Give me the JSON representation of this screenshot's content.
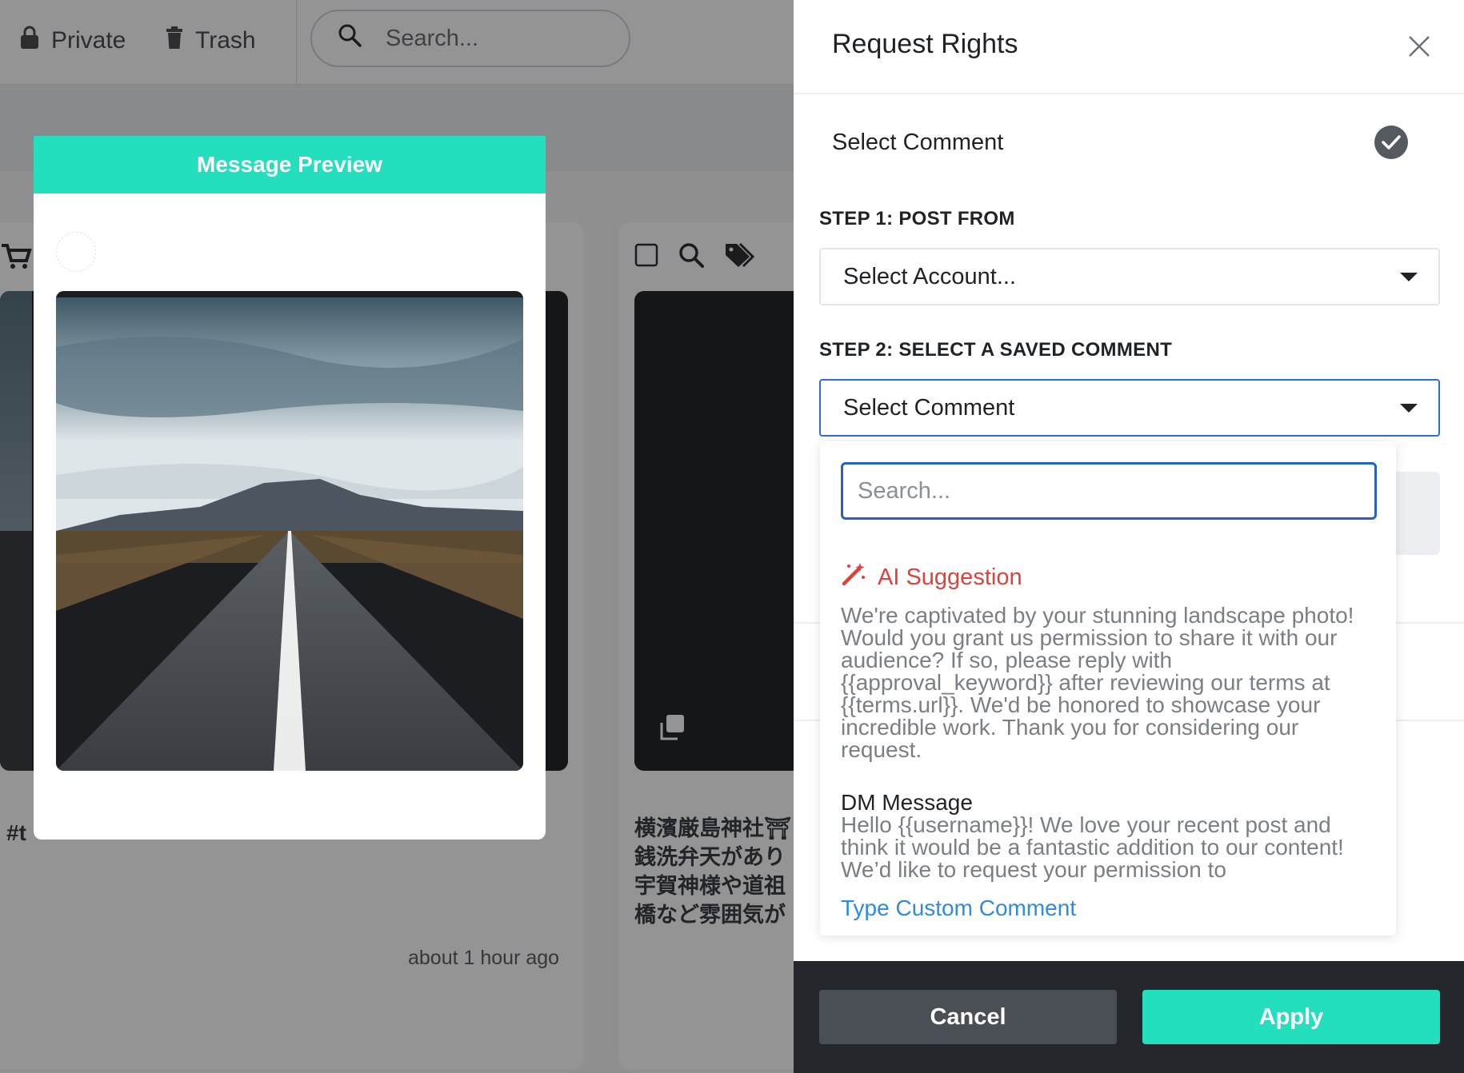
{
  "topbar": {
    "private_label": "Private",
    "trash_label": "Trash",
    "search_placeholder": "Search..."
  },
  "background": {
    "card_hashtag": "#t",
    "time_ago": "about 1 hour ago",
    "jp_caption": "横濱厳島神社⛩\n銭洗弁天があり\n宇賀神様や道祖\n橋など雰囲気が"
  },
  "preview": {
    "title": "Message Preview"
  },
  "drawer": {
    "title": "Request Rights",
    "select_comment_label": "Select Comment",
    "step1_label": "STEP 1: POST FROM",
    "step1_value": "Select Account...",
    "step2_label": "STEP 2: SELECT A SAVED COMMENT",
    "step2_value": "Select Comment",
    "menu": {
      "search_placeholder": "Search...",
      "ai_title": "AI Suggestion",
      "ai_text": "We're captivated by your stunning landscape photo! Would you grant us permission to share it with our audience? If so, please reply with {{approval_keyword}} after reviewing our terms at {{terms.url}}. We'd be honored to showcase your incredible work. Thank you for considering our request.",
      "dm_title": "DM Message",
      "dm_text": "Hello {{username}}! We love your recent post and think it would be a fantastic addition to our content! We’d like to request your permission to",
      "custom_link": "Type Custom Comment"
    },
    "cancel_label": "Cancel",
    "apply_label": "Apply"
  },
  "colors": {
    "accent": "#24dfbe",
    "ai_red": "#e0413b",
    "link_blue": "#2f8ae0",
    "focus_blue": "#2562c4",
    "footer_dark": "#24282d"
  }
}
